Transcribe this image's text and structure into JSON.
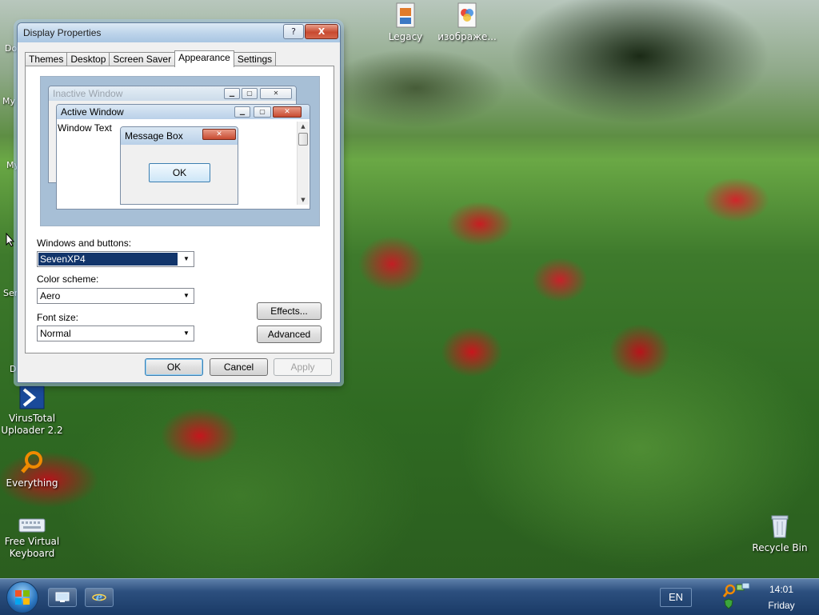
{
  "desktop": {
    "icons": [
      {
        "label": "Legacy"
      },
      {
        "label": "изображе..."
      },
      {
        "label": "VirusTotal Uploader 2.2"
      },
      {
        "label": "Everything"
      },
      {
        "label": "Free Virtual Keyboard"
      },
      {
        "label": "Recycle Bin"
      }
    ],
    "left_fragments": [
      "Do",
      "My C",
      "My",
      "Ser",
      "D"
    ]
  },
  "dialog": {
    "title": "Display Properties",
    "help_label": "?",
    "close_label": "X",
    "tabs": [
      {
        "label": "Themes"
      },
      {
        "label": "Desktop"
      },
      {
        "label": "Screen Saver"
      },
      {
        "label": "Appearance",
        "active": true
      },
      {
        "label": "Settings"
      }
    ],
    "preview": {
      "inactive_title": "Inactive Window",
      "active_title": "Active Window",
      "window_text": "Window Text",
      "message_title": "Message Box",
      "ok_label": "OK"
    },
    "windows_buttons_label": "Windows and buttons:",
    "windows_buttons_value": "SevenXP4",
    "color_scheme_label": "Color scheme:",
    "color_scheme_value": "Aero",
    "font_size_label": "Font size:",
    "font_size_value": "Normal",
    "effects_label": "Effects...",
    "advanced_label": "Advanced",
    "ok_label": "OK",
    "cancel_label": "Cancel",
    "apply_label": "Apply"
  },
  "taskbar": {
    "language": "EN",
    "time": "14:01",
    "day": "Friday"
  },
  "colors": {
    "taskbar": "#1a3a66",
    "selection": "#12356b",
    "close_red": "#c84a30"
  }
}
